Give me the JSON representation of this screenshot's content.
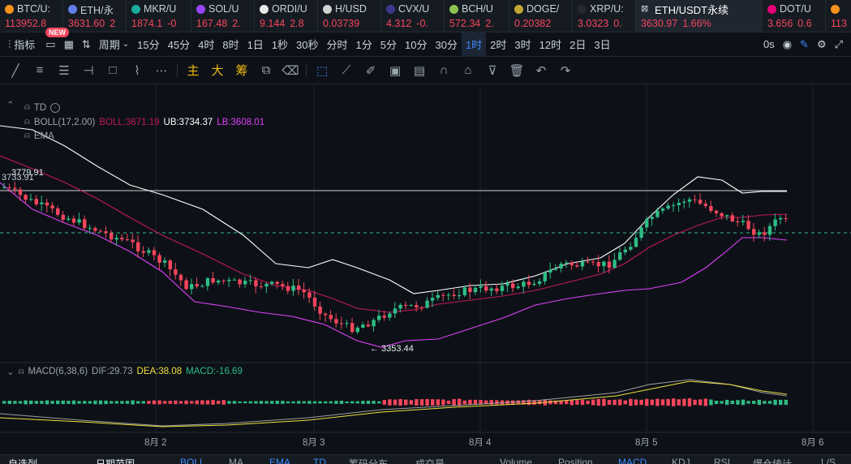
{
  "tickers": [
    {
      "sym": "BTC/U:",
      "price": "113952.8",
      "chg": "",
      "dir": "dn",
      "coin": "#f7931a"
    },
    {
      "sym": "ETH/永",
      "price": "3631.60",
      "chg": "2",
      "dir": "dn",
      "coin": "#627eea"
    },
    {
      "sym": "MKR/U",
      "price": "1874.1",
      "chg": "-0",
      "dir": "dn",
      "coin": "#1aab9b"
    },
    {
      "sym": "SOL/U",
      "price": "167.48",
      "chg": "2.",
      "dir": "dn",
      "coin": "#9945ff"
    },
    {
      "sym": "ORDI/U",
      "price": "9.144",
      "chg": "2.8",
      "dir": "dn",
      "coin": "#e8e8e8"
    },
    {
      "sym": "H/USD",
      "price": "0.03739",
      "chg": "",
      "dir": "dn",
      "coin": "#d0d0d0"
    },
    {
      "sym": "CVX/U",
      "price": "4.312",
      "chg": "-0.",
      "dir": "dn",
      "coin": "#3a3a8c"
    },
    {
      "sym": "BCH/U",
      "price": "572.34",
      "chg": "2.",
      "dir": "dn",
      "coin": "#8dc351"
    },
    {
      "sym": "DOGE/",
      "price": "0.20382",
      "chg": "",
      "dir": "dn",
      "coin": "#c2a633"
    },
    {
      "sym": "XRP/U:",
      "price": "3.0323",
      "chg": "0.",
      "dir": "dn",
      "coin": "#23292f"
    },
    {
      "sym": "ETH/USDT永续",
      "price": "3630.97",
      "chg": "1.66%",
      "dir": "dn",
      "coin": "#ffffff"
    },
    {
      "sym": "DOT/U",
      "price": "3.656",
      "chg": "0.6",
      "dir": "dn",
      "coin": "#e6007a"
    },
    {
      "sym": "",
      "price": "113",
      "chg": "",
      "dir": "dn",
      "coin": "#f7931a"
    }
  ],
  "toolbar": {
    "indicator": "指标",
    "new_badge": "NEW",
    "period": "周期",
    "intervals": [
      "15分",
      "45分",
      "4时",
      "8时",
      "1日",
      "1秒",
      "30秒",
      "分时",
      "1分",
      "5分",
      "10分",
      "30分",
      "1时",
      "2时",
      "3时",
      "12时",
      "2日",
      "3日"
    ],
    "selected_interval": "1时",
    "countdown": "0s"
  },
  "drawbar": {
    "cn_tools": [
      "主",
      "大",
      "筹"
    ]
  },
  "chart": {
    "legend_td": "TD",
    "legend_boll": "BOLL(17,2.00)",
    "boll_mid": "BOLL:3671.19",
    "boll_ub": "UB:3734.37",
    "boll_lb": "LB:3608.01",
    "legend_ema": "EMA",
    "price_high_label": "3779.91",
    "price_left_label": "3733.91",
    "price_low_label": "← 3353.44",
    "macd_label": "MACD(6,38,6)",
    "dif": "DIF:29.73",
    "dea": "DEA:38.08",
    "macd": "MACD:-16.69",
    "x_dates": [
      "8月 2",
      "8月 3",
      "8月 4",
      "8月 5",
      "8月 6"
    ],
    "colors": {
      "up": "#2ebd85",
      "down": "#f6465d",
      "boll_mid": "#c2185b",
      "boll_band": "#e040fb",
      "ub": "#ffffff",
      "dif": "#9e9e9e",
      "dea": "#f0e040"
    }
  },
  "chart_data": {
    "type": "candlestick",
    "x": [
      "8月 2",
      "8月 3",
      "8月 4",
      "8月 5",
      "8月 6"
    ],
    "annotations": [
      {
        "label": "3779.91"
      },
      {
        "label": "3353.44"
      }
    ],
    "boll": {
      "mid": 3671.19,
      "ub": 3734.37,
      "lb": 3608.01
    }
  },
  "bottom": {
    "left1": "自选列",
    "left2": "日期范围",
    "items": [
      "BOLL",
      "MA",
      "EMA",
      "TD",
      "筹码分布",
      "成交量",
      "Volume",
      "Position",
      "MACD",
      "KDJ",
      "RSI",
      "爆仓统计",
      "L/S"
    ]
  }
}
